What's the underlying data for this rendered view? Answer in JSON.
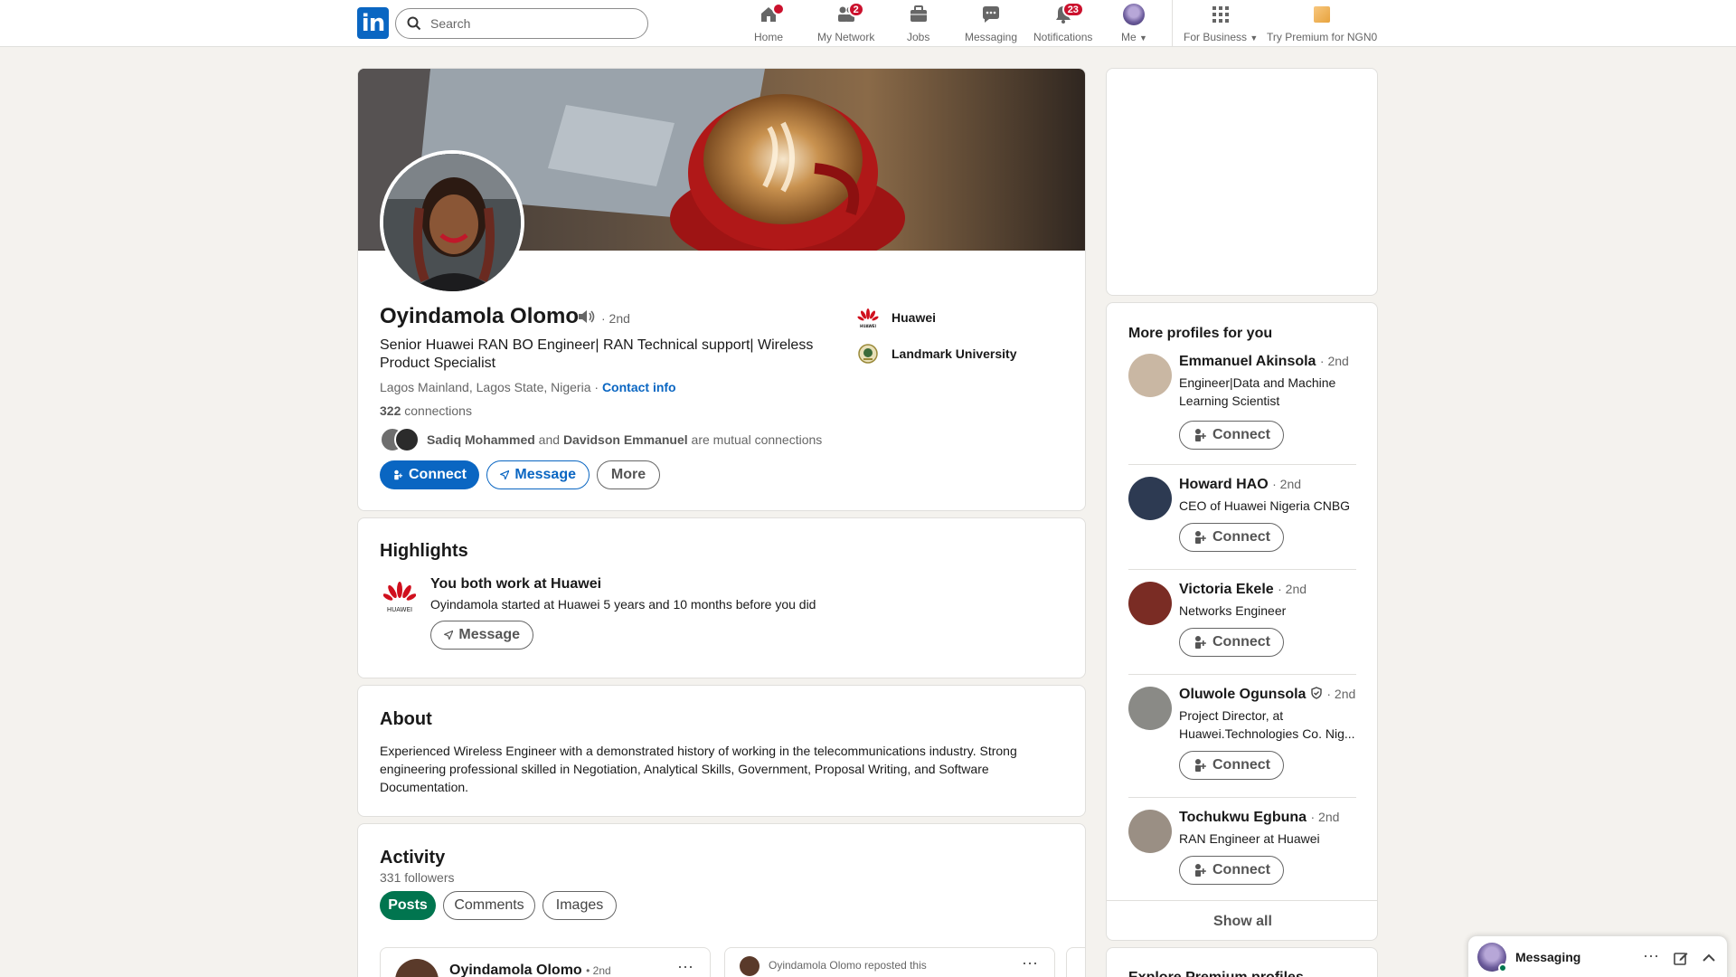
{
  "nav": {
    "search_placeholder": "Search",
    "items": [
      {
        "label": "Home",
        "icon": "home-icon",
        "badge_dot": true
      },
      {
        "label": "My Network",
        "icon": "people-icon",
        "badge": "2"
      },
      {
        "label": "Jobs",
        "icon": "briefcase-icon"
      },
      {
        "label": "Messaging",
        "icon": "messaging-icon"
      },
      {
        "label": "Notifications",
        "icon": "bell-icon",
        "badge": "23"
      },
      {
        "label": "Me",
        "icon": "avatar-icon"
      },
      {
        "label": "For Business",
        "icon": "grid-icon"
      },
      {
        "label": "Try Premium for NGN0",
        "icon": "premium-icon"
      }
    ]
  },
  "profile": {
    "name": "Oyindamola Olomo",
    "degree": "· 2nd",
    "headline": "Senior Huawei RAN BO Engineer| RAN Technical support| Wireless Product Specialist",
    "location": "Lagos Mainland, Lagos State, Nigeria",
    "location_sep": " · ",
    "contact_info": "Contact info",
    "connections_count": "322",
    "connections_label": " connections",
    "mutual_a": "Sadiq Mohammed",
    "mutual_and": " and ",
    "mutual_b": "Davidson Emmanuel",
    "mutual_suffix": " are mutual connections",
    "company": "Huawei",
    "school": "Landmark University",
    "connect_label": "Connect",
    "message_label": "Message",
    "more_label": "More"
  },
  "highlights": {
    "title": "Highlights",
    "heading": "You both work at Huawei",
    "detail": "Oyindamola started at Huawei 5 years and 10 months before you did",
    "message_label": "Message",
    "logo_text": "HUAWEI"
  },
  "about": {
    "title": "About",
    "text": "Experienced Wireless Engineer with a demonstrated history of working in the telecommunications industry. Strong engineering professional skilled in Negotiation, Analytical Skills, Government, Proposal Writing, and Software Documentation."
  },
  "activity": {
    "title": "Activity",
    "followers": "331 followers",
    "tabs": [
      "Posts",
      "Comments",
      "Images"
    ],
    "post1_author": "Oyindamola Olomo",
    "post1_degree": "• 2nd",
    "post2_header": "Oyindamola Olomo reposted this"
  },
  "sidebar": {
    "title": "More profiles for you",
    "connect_label": "Connect",
    "show_all": "Show all",
    "next_title": "Explore Premium profiles",
    "people": [
      {
        "name": "Emmanuel Akinsola",
        "degree": "· 2nd",
        "title": "Engineer|Data and Machine Learning Scientist"
      },
      {
        "name": "Howard HAO",
        "degree": "· 2nd",
        "title": "CEO of Huawei Nigeria CNBG"
      },
      {
        "name": "Victoria Ekele",
        "degree": "· 2nd",
        "title": "Networks Engineer"
      },
      {
        "name": "Oluwole Ogunsola",
        "degree": "· 2nd",
        "title": "Project Director, at Huawei.Technologies Co. Nig...",
        "verified": true
      },
      {
        "name": "Tochukwu Egbuna",
        "degree": "· 2nd",
        "title": "RAN Engineer at Huawei"
      }
    ]
  },
  "messaging": {
    "label": "Messaging"
  },
  "colors": {
    "brand": "#0a66c2",
    "badge": "#cb112d",
    "posts_tab": "#01754f",
    "background": "#f4f2ee"
  }
}
